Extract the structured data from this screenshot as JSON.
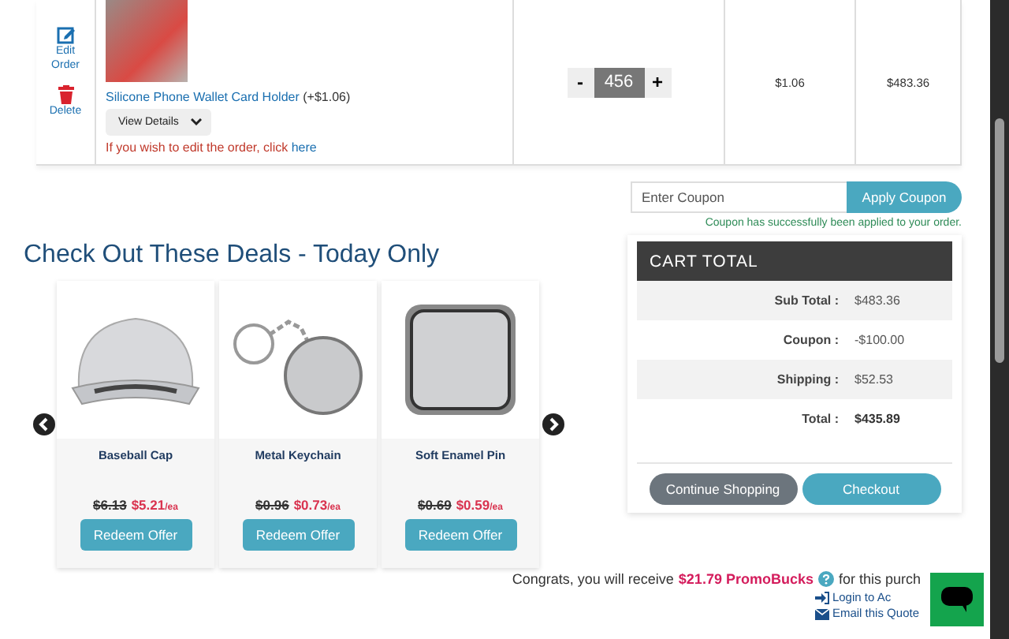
{
  "cart_row": {
    "actions": [
      {
        "kind": "edit",
        "label": "Edit Order"
      },
      {
        "kind": "delete",
        "label": "Delete"
      }
    ],
    "product": {
      "name": "Silicone Phone Wallet Card Holder",
      "price_add": "(+$1.06)",
      "details_button": "View Details",
      "edit_note": "If you wish to edit the order, click",
      "edit_link": "here"
    },
    "quantity": {
      "minus": "-",
      "value": "456",
      "plus": "+"
    },
    "unit_price": "$1.06",
    "line_total": "$483.36"
  },
  "coupon": {
    "placeholder": "Enter Coupon",
    "button": "Apply Coupon",
    "message": "Coupon has successfully been applied to your order."
  },
  "deals": {
    "title": "Check Out These Deals - Today Only",
    "items": [
      {
        "kind": "cap",
        "name": "Baseball Cap",
        "old_price": "$6.13",
        "new_price": "$5.21",
        "unit": "/ea",
        "button": "Redeem Offer"
      },
      {
        "kind": "keychain",
        "name": "Metal Keychain",
        "old_price": "$0.96",
        "new_price": "$0.73",
        "unit": "/ea",
        "button": "Redeem Offer"
      },
      {
        "kind": "pin",
        "name": "Soft Enamel Pin",
        "old_price": "$0.69",
        "new_price": "$0.59",
        "unit": "/ea",
        "button": "Redeem Offer"
      }
    ]
  },
  "cart_total": {
    "title": "CART TOTAL",
    "rows": [
      {
        "kind": "line",
        "label": "Sub Total :",
        "value": "$483.36"
      },
      {
        "kind": "line",
        "label": "Coupon :",
        "value": "-$100.00"
      },
      {
        "kind": "line",
        "label": "Shipping :",
        "value": "$52.53"
      },
      {
        "kind": "total",
        "label": "Total :",
        "value": "$435.89"
      }
    ],
    "buttons": [
      {
        "kind": "secondary",
        "label": "Continue Shopping"
      },
      {
        "kind": "primary",
        "label": "Checkout"
      }
    ]
  },
  "promo": {
    "prefix": "Congrats, you will receive",
    "amount": "$21.79 PromoBucks",
    "suffix": "for this purch"
  },
  "links": [
    {
      "kind": "login",
      "label": "Login to Ac"
    },
    {
      "kind": "email",
      "label": "Email this Quote"
    }
  ]
}
